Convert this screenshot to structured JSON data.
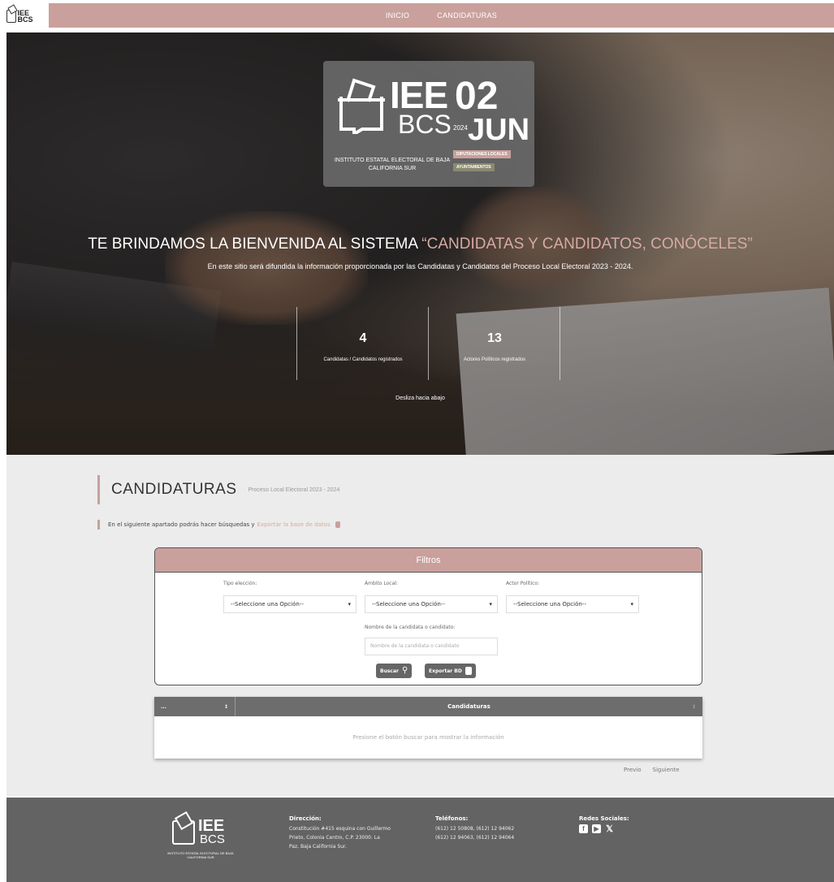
{
  "nav": {
    "logo_text": "IEE BCS",
    "items": [
      {
        "label": "INICIO"
      },
      {
        "label": "CANDIDATURAS"
      }
    ]
  },
  "hero": {
    "brand": {
      "iee": "IEE",
      "bcs": "BCS",
      "day": "02",
      "year": "2024",
      "month": "JUN",
      "institute": "INSTITUTO ESTATAL ELECTORAL DE BAJA CALIFORNIA SUR",
      "tag1": "DIPUTACIONES LOCALES",
      "tag2": "AYUNTAMIENTOS"
    },
    "title_main": "TE BRINDAMOS LA BIENVENIDA AL SISTEMA ",
    "title_accent": "“CANDIDATAS Y CANDIDATOS, CONÓCELES”",
    "subtitle": "En este sitio será difundida la información proporcionada por las Candidatas y Candidatos del Proceso Local Electoral 2023 - 2024.",
    "stats": [
      {
        "value": "4",
        "label": "Candidatas / Candidatos registrados"
      },
      {
        "value": "13",
        "label": "Actores Políticos registrados"
      }
    ],
    "scroll_hint": "Desliza hacia abajo"
  },
  "section": {
    "title": "CANDIDATURAS",
    "subtitle": "Proceso Local Electoral 2023 - 2024",
    "intro": "En el siguiente apartado podrás hacer búsquedas y",
    "export_link": "Exportar la base de datos"
  },
  "filters": {
    "header": "Filtros",
    "tipo_label": "Tipo elección:",
    "ambito_label": "Ámbito Local:",
    "actor_label": "Actor Político:",
    "select_value": "--Seleccione una Opción--",
    "name_label": "Nombre de la candidata o candidato:",
    "name_placeholder": "Nombre de la candidata o candidato",
    "search_button": "Buscar",
    "export_button": "Exportar BD"
  },
  "table": {
    "col1": "...",
    "col2": "Candidaturas",
    "empty_message": "Presione el botón buscar para mostrar la información",
    "prev": "Previo",
    "next": "Siguiente"
  },
  "footer": {
    "logo_iee": "IEE",
    "logo_bcs": "BCS",
    "logo_inst": "INSTITUTO ESTATAL ELECTORAL DE BAJA CALIFORNIA SUR",
    "address_title": "Dirección:",
    "address_lines": [
      "Constitución #415 esquina con Guillermo",
      "Prieto, Colonia Centro, C.P. 23000. La",
      "Paz, Baja California Sur."
    ],
    "phones_title": "Teléfonos:",
    "phones_lines": [
      "(612) 12 50808, (612) 12 94062",
      "(612) 12 94063, (612) 12 94064"
    ],
    "social_title": "Redes Sociales:",
    "social_icons": [
      "facebook-icon",
      "youtube-icon",
      "x-icon"
    ]
  }
}
